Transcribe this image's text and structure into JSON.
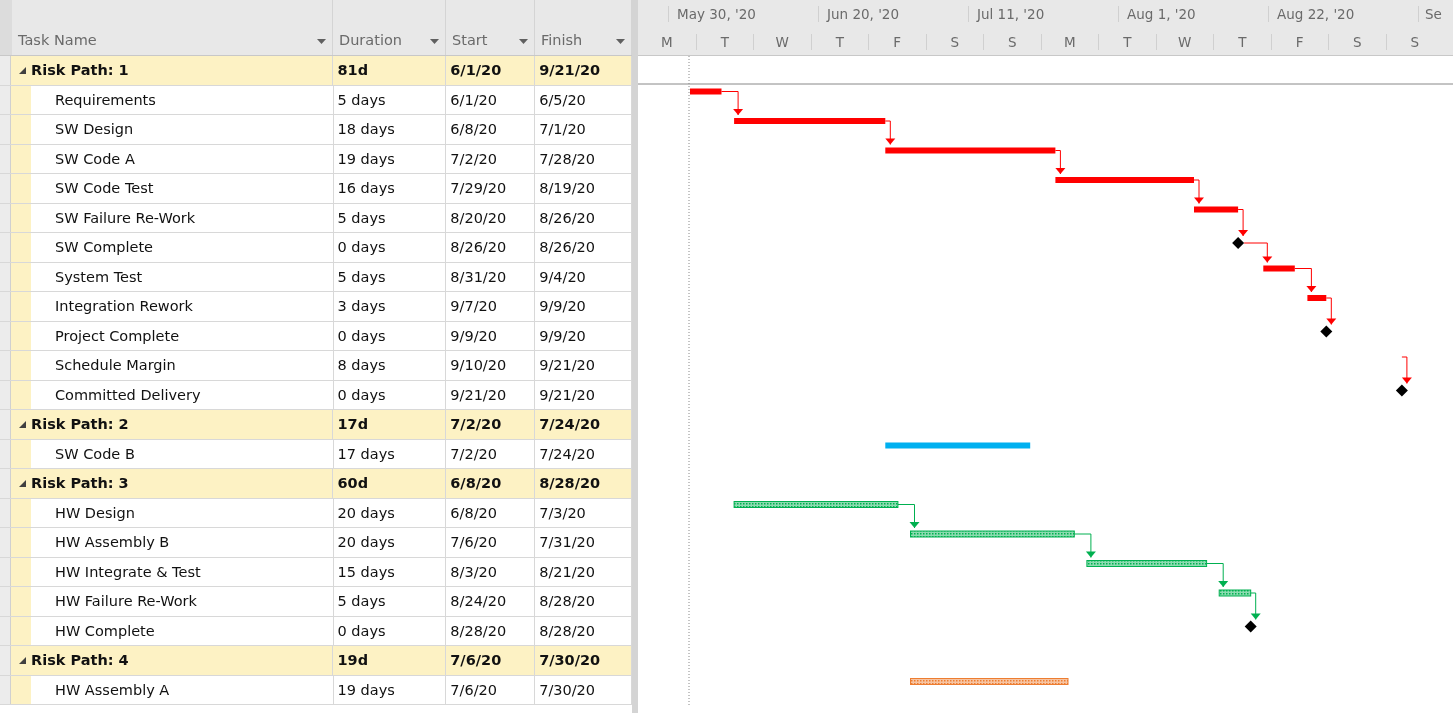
{
  "table": {
    "columns": [
      {
        "label": "Task Name"
      },
      {
        "label": "Duration"
      },
      {
        "label": "Start"
      },
      {
        "label": "Finish"
      }
    ]
  },
  "timescale": {
    "top": [
      "May 30, '20",
      "Jun 20, '20",
      "Jul 11, '20",
      "Aug 1, '20",
      "Aug 22, '20",
      "Se"
    ],
    "bottom": [
      "M",
      "T",
      "W",
      "T",
      "F",
      "S",
      "S",
      "M",
      "T",
      "W",
      "T",
      "F",
      "S",
      "S"
    ]
  },
  "groups": [
    {
      "name": "Risk Path: 1",
      "duration": "81d",
      "start": "6/1/20",
      "finish": "9/21/20",
      "expanded": true,
      "color": "#ff0000",
      "hatched": false,
      "children": [
        {
          "name": "Requirements",
          "duration": "5 days",
          "start": "6/1/20",
          "finish": "6/5/20",
          "kind": "task"
        },
        {
          "name": "SW Design",
          "duration": "18 days",
          "start": "6/8/20",
          "finish": "7/1/20",
          "kind": "task"
        },
        {
          "name": "SW Code A",
          "duration": "19 days",
          "start": "7/2/20",
          "finish": "7/28/20",
          "kind": "task"
        },
        {
          "name": "SW Code Test",
          "duration": "16 days",
          "start": "7/29/20",
          "finish": "8/19/20",
          "kind": "task"
        },
        {
          "name": "SW Failure Re-Work",
          "duration": "5 days",
          "start": "8/20/20",
          "finish": "8/26/20",
          "kind": "task"
        },
        {
          "name": "SW Complete",
          "duration": "0 days",
          "start": "8/26/20",
          "finish": "8/26/20",
          "kind": "milestone"
        },
        {
          "name": "System Test",
          "duration": "5 days",
          "start": "8/31/20",
          "finish": "9/4/20",
          "kind": "task"
        },
        {
          "name": "Integration Rework",
          "duration": "3 days",
          "start": "9/7/20",
          "finish": "9/9/20",
          "kind": "task"
        },
        {
          "name": "Project Complete",
          "duration": "0 days",
          "start": "9/9/20",
          "finish": "9/9/20",
          "kind": "milestone"
        },
        {
          "name": "Schedule Margin",
          "duration": "8 days",
          "start": "9/10/20",
          "finish": "9/21/20",
          "kind": "margin"
        },
        {
          "name": "Committed Delivery",
          "duration": "0 days",
          "start": "9/21/20",
          "finish": "9/21/20",
          "kind": "milestone"
        }
      ]
    },
    {
      "name": "Risk Path: 2",
      "duration": "17d",
      "start": "7/2/20",
      "finish": "7/24/20",
      "expanded": true,
      "color": "#00b0f0",
      "hatched": false,
      "children": [
        {
          "name": "SW Code B",
          "duration": "17 days",
          "start": "7/2/20",
          "finish": "7/24/20",
          "kind": "task"
        }
      ]
    },
    {
      "name": "Risk Path: 3",
      "duration": "60d",
      "start": "6/8/20",
      "finish": "8/28/20",
      "expanded": true,
      "color": "#00b050",
      "hatched": true,
      "children": [
        {
          "name": "HW Design",
          "duration": "20 days",
          "start": "6/8/20",
          "finish": "7/3/20",
          "kind": "task"
        },
        {
          "name": "HW Assembly B",
          "duration": "20 days",
          "start": "7/6/20",
          "finish": "7/31/20",
          "kind": "task"
        },
        {
          "name": "HW Integrate & Test",
          "duration": "15 days",
          "start": "8/3/20",
          "finish": "8/21/20",
          "kind": "task"
        },
        {
          "name": "HW Failure Re-Work",
          "duration": "5 days",
          "start": "8/24/20",
          "finish": "8/28/20",
          "kind": "task"
        },
        {
          "name": "HW Complete",
          "duration": "0 days",
          "start": "8/28/20",
          "finish": "8/28/20",
          "kind": "milestone"
        }
      ]
    },
    {
      "name": "Risk Path: 4",
      "duration": "19d",
      "start": "7/6/20",
      "finish": "7/30/20",
      "expanded": true,
      "color": "#ed7d31",
      "hatched": true,
      "children": [
        {
          "name": "HW Assembly A",
          "duration": "19 days",
          "start": "7/6/20",
          "finish": "7/30/20",
          "kind": "task"
        }
      ]
    }
  ]
}
